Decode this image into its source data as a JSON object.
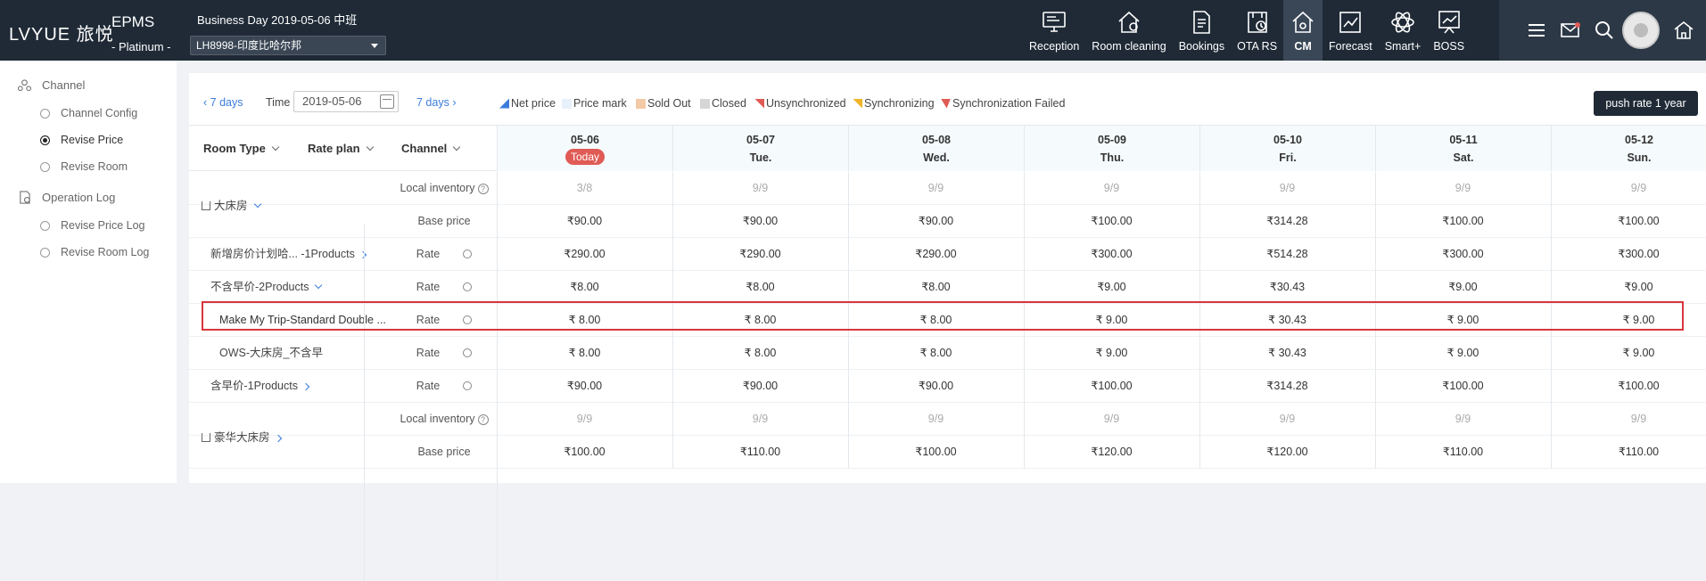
{
  "header": {
    "logo": "LVYUE 旅悦",
    "product": "EPMS",
    "plan": "- Platinum -",
    "business_day": "Business Day 2019-05-06 中班",
    "hotel": "LH8998-印度比哈尔邦"
  },
  "nav": [
    {
      "label": "Reception",
      "icon": "monitor-icon"
    },
    {
      "label": "Room cleaning",
      "icon": "house-clean-icon"
    },
    {
      "label": "Bookings",
      "icon": "document-icon"
    },
    {
      "label": "OTA RS",
      "icon": "ota-clock-icon"
    },
    {
      "label": "CM",
      "icon": "house-cog-icon"
    },
    {
      "label": "Forecast",
      "icon": "chart-icon"
    },
    {
      "label": "Smart+",
      "icon": "atom-icon"
    },
    {
      "label": "BOSS",
      "icon": "boss-chart-icon"
    }
  ],
  "sidebar": {
    "channel": "Channel",
    "channel_items": [
      "Channel Config",
      "Revise Price",
      "Revise Room"
    ],
    "oplog": "Operation Log",
    "oplog_items": [
      "Revise Price Log",
      "Revise Room Log"
    ]
  },
  "toolbar": {
    "prev": "7 days",
    "time_label": "Time",
    "date": "2019-05-06",
    "next": "7 days",
    "push": "push rate 1 year",
    "legend": [
      {
        "label": "Net price",
        "color": "#3b7ddd"
      },
      {
        "label": "Price mark",
        "color": "#e8f0fb"
      },
      {
        "label": "Sold Out",
        "color": "#f3c9a6"
      },
      {
        "label": "Closed",
        "color": "#d6d6d6"
      },
      {
        "label": "Unsynchronized",
        "color": "#e05b55"
      },
      {
        "label": "Synchronizing",
        "color": "#f0b429"
      },
      {
        "label": "Synchronization Failed",
        "color": "#e05b55"
      }
    ]
  },
  "grid": {
    "col_room_type": "Room Type",
    "col_rate_plan": "Rate plan",
    "col_channel": "Channel",
    "today_badge": "Today",
    "dates": [
      {
        "d": "05-06",
        "w": ""
      },
      {
        "d": "05-07",
        "w": "Tue."
      },
      {
        "d": "05-08",
        "w": "Wed."
      },
      {
        "d": "05-09",
        "w": "Thu."
      },
      {
        "d": "05-10",
        "w": "Fri."
      },
      {
        "d": "05-11",
        "w": "Sat."
      },
      {
        "d": "05-12",
        "w": "Sun."
      }
    ],
    "rows": [
      {
        "label": "",
        "channel": "Local inventory",
        "values": [
          "3/8",
          "9/9",
          "9/9",
          "9/9",
          "9/9",
          "9/9",
          "9/9"
        ]
      },
      {
        "label": "",
        "channel": "Base price",
        "values": [
          "₹90.00",
          "₹90.00",
          "₹90.00",
          "₹100.00",
          "₹314.28",
          "₹100.00",
          "₹100.00"
        ]
      },
      {
        "label": "新增房价计划哈... -1Products",
        "channel": "Rate",
        "values": [
          "₹290.00",
          "₹290.00",
          "₹290.00",
          "₹300.00",
          "₹514.28",
          "₹300.00",
          "₹300.00"
        ]
      },
      {
        "label": "不含早价-2Products",
        "channel": "Rate",
        "values": [
          "₹8.00",
          "₹8.00",
          "₹8.00",
          "₹9.00",
          "₹30.43",
          "₹9.00",
          "₹9.00"
        ]
      },
      {
        "label": "Make My Trip-Standard Double ...",
        "channel": "Rate",
        "values": [
          "₹ 8.00",
          "₹ 8.00",
          "₹ 8.00",
          "₹ 9.00",
          "₹ 30.43",
          "₹ 9.00",
          "₹ 9.00"
        ]
      },
      {
        "label": "OWS-大床房_不含早",
        "channel": "Rate",
        "values": [
          "₹ 8.00",
          "₹ 8.00",
          "₹ 8.00",
          "₹ 9.00",
          "₹ 30.43",
          "₹ 9.00",
          "₹ 9.00"
        ]
      },
      {
        "label": "含早价-1Products",
        "channel": "Rate",
        "values": [
          "₹90.00",
          "₹90.00",
          "₹90.00",
          "₹100.00",
          "₹314.28",
          "₹100.00",
          "₹100.00"
        ]
      },
      {
        "label": "",
        "channel": "Local inventory",
        "values": [
          "9/9",
          "9/9",
          "9/9",
          "9/9",
          "9/9",
          "9/9",
          "9/9"
        ]
      },
      {
        "label": "",
        "channel": "Base price",
        "values": [
          "₹100.00",
          "₹110.00",
          "₹100.00",
          "₹120.00",
          "₹120.00",
          "₹110.00",
          "₹110.00"
        ]
      }
    ],
    "room_types": [
      "大床房",
      "豪华大床房"
    ]
  }
}
